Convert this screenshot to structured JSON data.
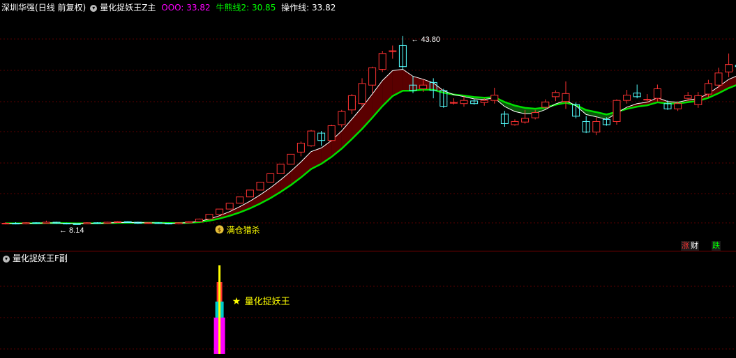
{
  "header": {
    "stock_name": "深圳华强",
    "period": "(日线 前复权)",
    "indicator": "量化捉妖王Z主",
    "ooo_label": "OOO:",
    "ooo_value": "33.82",
    "bull_label": "牛熊线2:",
    "bull_value": "30.85",
    "op_label": "操作线:",
    "op_value": "33.82"
  },
  "colors": {
    "up": "#ff3232",
    "down": "#54ffff",
    "ooo": "#ff00ff",
    "bull": "#00e000",
    "op_line": "#ffffff",
    "fill_red": "#5a0000",
    "fill_green": "#0a5a0a",
    "grid": "#5a0000"
  },
  "annotations": {
    "high_label": "43.80",
    "low_label": "8.14",
    "signal_icon": "money-bag-icon",
    "signal_text": "满仓猎杀",
    "rise_badge": "涨",
    "wealth_badge": "财",
    "fall_badge": "跌"
  },
  "sub": {
    "title": "量化捉妖王F副",
    "label": "量化捉妖王"
  },
  "chart_data": {
    "type": "candlestick",
    "ylim": [
      6,
      48
    ],
    "candles": [
      [
        0,
        8.2,
        8.3,
        8.1,
        8.5
      ],
      [
        1,
        8.3,
        8.2,
        8.1,
        8.5
      ],
      [
        2,
        8.2,
        8.4,
        8.1,
        8.5
      ],
      [
        3,
        8.4,
        8.3,
        8.2,
        8.5
      ],
      [
        4,
        8.3,
        8.5,
        8.2,
        8.8
      ],
      [
        5,
        8.5,
        8.3,
        8.2,
        8.6
      ],
      [
        6,
        8.3,
        8.2,
        8.1,
        8.4
      ],
      [
        7,
        8.2,
        8.15,
        8.14,
        8.3
      ],
      [
        8,
        8.2,
        8.4,
        8.14,
        8.5
      ],
      [
        9,
        8.4,
        8.3,
        8.2,
        8.5
      ],
      [
        10,
        8.3,
        8.5,
        8.2,
        8.6
      ],
      [
        11,
        8.5,
        8.6,
        8.4,
        8.7
      ],
      [
        12,
        8.6,
        8.5,
        8.4,
        8.7
      ],
      [
        13,
        8.5,
        8.3,
        8.2,
        8.6
      ],
      [
        14,
        8.3,
        8.4,
        8.2,
        8.5
      ],
      [
        15,
        8.4,
        8.3,
        8.2,
        8.5
      ],
      [
        16,
        8.3,
        8.2,
        8.1,
        8.4
      ],
      [
        17,
        8.2,
        8.4,
        8.1,
        8.5
      ],
      [
        18,
        8.4,
        8.6,
        8.3,
        8.7
      ],
      [
        19,
        8.6,
        9.1,
        8.5,
        9.2
      ],
      [
        20,
        9.1,
        10.0,
        9.0,
        10.0
      ],
      [
        21,
        10.0,
        11.0,
        10.0,
        11.0
      ],
      [
        22,
        11.0,
        12.1,
        11.0,
        12.1
      ],
      [
        23,
        12.1,
        13.3,
        12.1,
        13.3
      ],
      [
        24,
        13.3,
        14.6,
        13.3,
        14.6
      ],
      [
        25,
        14.6,
        16.1,
        14.6,
        16.1
      ],
      [
        26,
        16.1,
        17.7,
        16.1,
        17.7
      ],
      [
        27,
        17.7,
        19.5,
        17.7,
        19.5
      ],
      [
        28,
        19.5,
        21.4,
        19.5,
        21.4
      ],
      [
        29,
        21.8,
        23.5,
        21.0,
        23.8
      ],
      [
        30,
        23.0,
        25.8,
        22.8,
        26.0
      ],
      [
        31,
        25.4,
        24.0,
        23.0,
        25.8
      ],
      [
        32,
        24.0,
        26.8,
        23.8,
        27.0
      ],
      [
        33,
        27.0,
        29.5,
        26.5,
        29.8
      ],
      [
        34,
        29.8,
        32.5,
        29.0,
        32.8
      ],
      [
        35,
        31.0,
        34.8,
        30.5,
        35.8
      ],
      [
        36,
        34.5,
        37.8,
        33.0,
        38.0
      ],
      [
        37,
        37.5,
        40.5,
        37.0,
        41.0
      ],
      [
        38,
        41.0,
        41.0,
        39.5,
        42.0
      ],
      [
        39,
        42.0,
        38.0,
        37.5,
        43.8
      ],
      [
        40,
        34.5,
        33.5,
        33.0,
        36.2
      ],
      [
        41,
        33.8,
        34.5,
        33.2,
        35.6
      ],
      [
        42,
        35.0,
        33.5,
        32.0,
        35.8
      ],
      [
        43,
        33.5,
        30.5,
        30.2,
        33.8
      ],
      [
        44,
        31.2,
        31.2,
        30.8,
        32.0
      ],
      [
        45,
        31.0,
        31.6,
        30.4,
        32.4
      ],
      [
        46,
        31.5,
        31.0,
        30.8,
        31.8
      ],
      [
        47,
        31.2,
        31.6,
        30.6,
        32.0
      ],
      [
        48,
        31.6,
        32.6,
        31.0,
        34.0
      ],
      [
        49,
        29.0,
        27.2,
        26.6,
        29.6
      ],
      [
        50,
        27.0,
        27.6,
        26.8,
        28.0
      ],
      [
        51,
        27.5,
        28.2,
        27.2,
        29.8
      ],
      [
        52,
        28.3,
        29.3,
        28.0,
        29.8
      ],
      [
        53,
        30.3,
        31.3,
        30.0,
        31.8
      ],
      [
        54,
        32.3,
        33.1,
        31.5,
        33.5
      ],
      [
        55,
        31.4,
        32.9,
        30.0,
        35.2
      ],
      [
        56,
        30.8,
        28.6,
        28.2,
        31.2
      ],
      [
        57,
        27.6,
        25.6,
        25.4,
        28.6
      ],
      [
        58,
        25.6,
        27.6,
        25.0,
        28.4
      ],
      [
        59,
        28.0,
        27.0,
        26.8,
        28.4
      ],
      [
        60,
        27.6,
        31.6,
        27.0,
        31.8
      ],
      [
        61,
        31.6,
        32.6,
        31.0,
        33.6
      ],
      [
        62,
        33.0,
        32.3,
        32.0,
        34.6
      ],
      [
        63,
        31.8,
        31.8,
        31.2,
        32.8
      ],
      [
        64,
        32.0,
        33.8,
        31.4,
        34.6
      ],
      [
        65,
        31.0,
        30.0,
        29.8,
        31.6
      ],
      [
        66,
        30.0,
        31.0,
        29.6,
        31.4
      ],
      [
        67,
        32.0,
        32.5,
        31.5,
        33.2
      ],
      [
        68,
        30.8,
        32.5,
        30.2,
        33.2
      ],
      [
        69,
        32.8,
        34.8,
        32.2,
        35.5
      ],
      [
        70,
        34.5,
        36.8,
        34.0,
        37.8
      ],
      [
        71,
        37.0,
        38.4,
        36.0,
        40.5
      ],
      [
        72,
        38.3,
        38.0,
        36.0,
        41.2
      ],
      [
        73,
        36.0,
        34.5,
        34.2,
        37.2
      ]
    ]
  }
}
